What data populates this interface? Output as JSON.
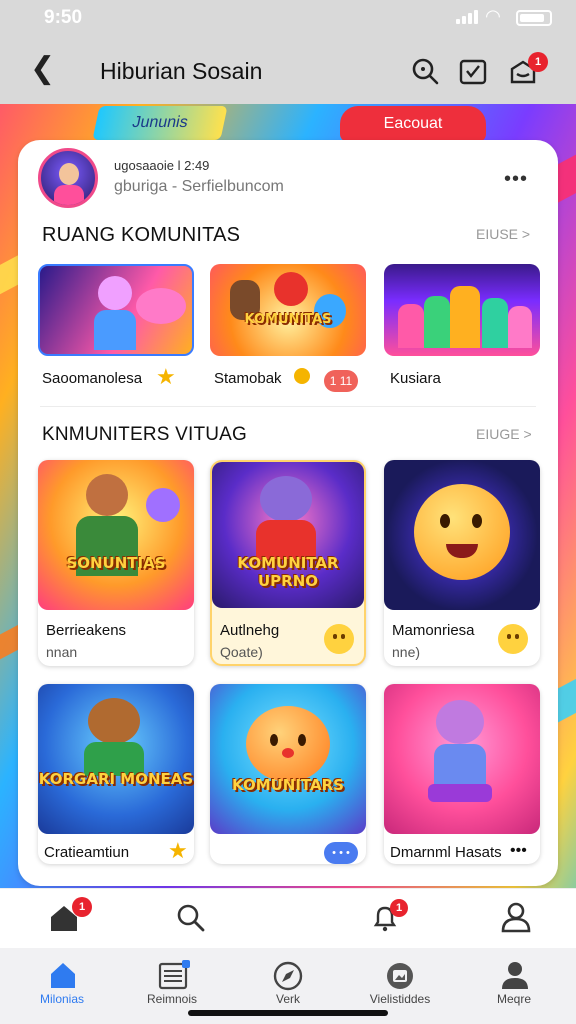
{
  "status_bar": {
    "time": "9:50"
  },
  "app_bar": {
    "title": "Hiburian Sosain",
    "notification_count": "1"
  },
  "pills": {
    "left": "Jununis",
    "right": "Eacouat"
  },
  "profile": {
    "line1": "ugosaaoie l 2:49",
    "line2": "gburiga - Serfielbuncom",
    "more": "•••"
  },
  "section1": {
    "title": "RUANG KOMUNITAS",
    "more": "EIUSE >",
    "tiles": [
      {
        "label": "Saoomanolesa",
        "badge": ""
      },
      {
        "label": "Stamobak",
        "art_text": "KOMUNITAS",
        "badge": "1 11"
      },
      {
        "label": "Kusiara"
      }
    ]
  },
  "section2": {
    "title": "KNMUNITERS VITUAG",
    "more": "EIUGE >",
    "cards": [
      {
        "art_text": "SONUNTIAS",
        "label": "Berrieakens",
        "sub": "nnan"
      },
      {
        "art_text": "KOMUNITAR UPRNO",
        "label": "Autlnehg",
        "sub": "Qoate)"
      },
      {
        "label": "Mamonriesa",
        "sub": "nne)"
      },
      {
        "art_text": "KORGARI MONEAS",
        "label": "Cratieamtiun"
      },
      {
        "art_text": "KOMUNITARS",
        "badge": "• • •"
      },
      {
        "label": "Dmarnml Hasats",
        "more": "•••"
      }
    ]
  },
  "bottom_nav_top": {
    "home_badge": "1",
    "bell_badge": "1"
  },
  "bottom_nav": [
    {
      "label": "Milonias",
      "active": true
    },
    {
      "label": "Reimnois"
    },
    {
      "label": "Verk"
    },
    {
      "label": "Vielistiddes"
    },
    {
      "label": "Meqre"
    }
  ],
  "colors": {
    "accent": "#2f7bf0",
    "badge": "#e8232e",
    "highlight": "#fff6da"
  }
}
